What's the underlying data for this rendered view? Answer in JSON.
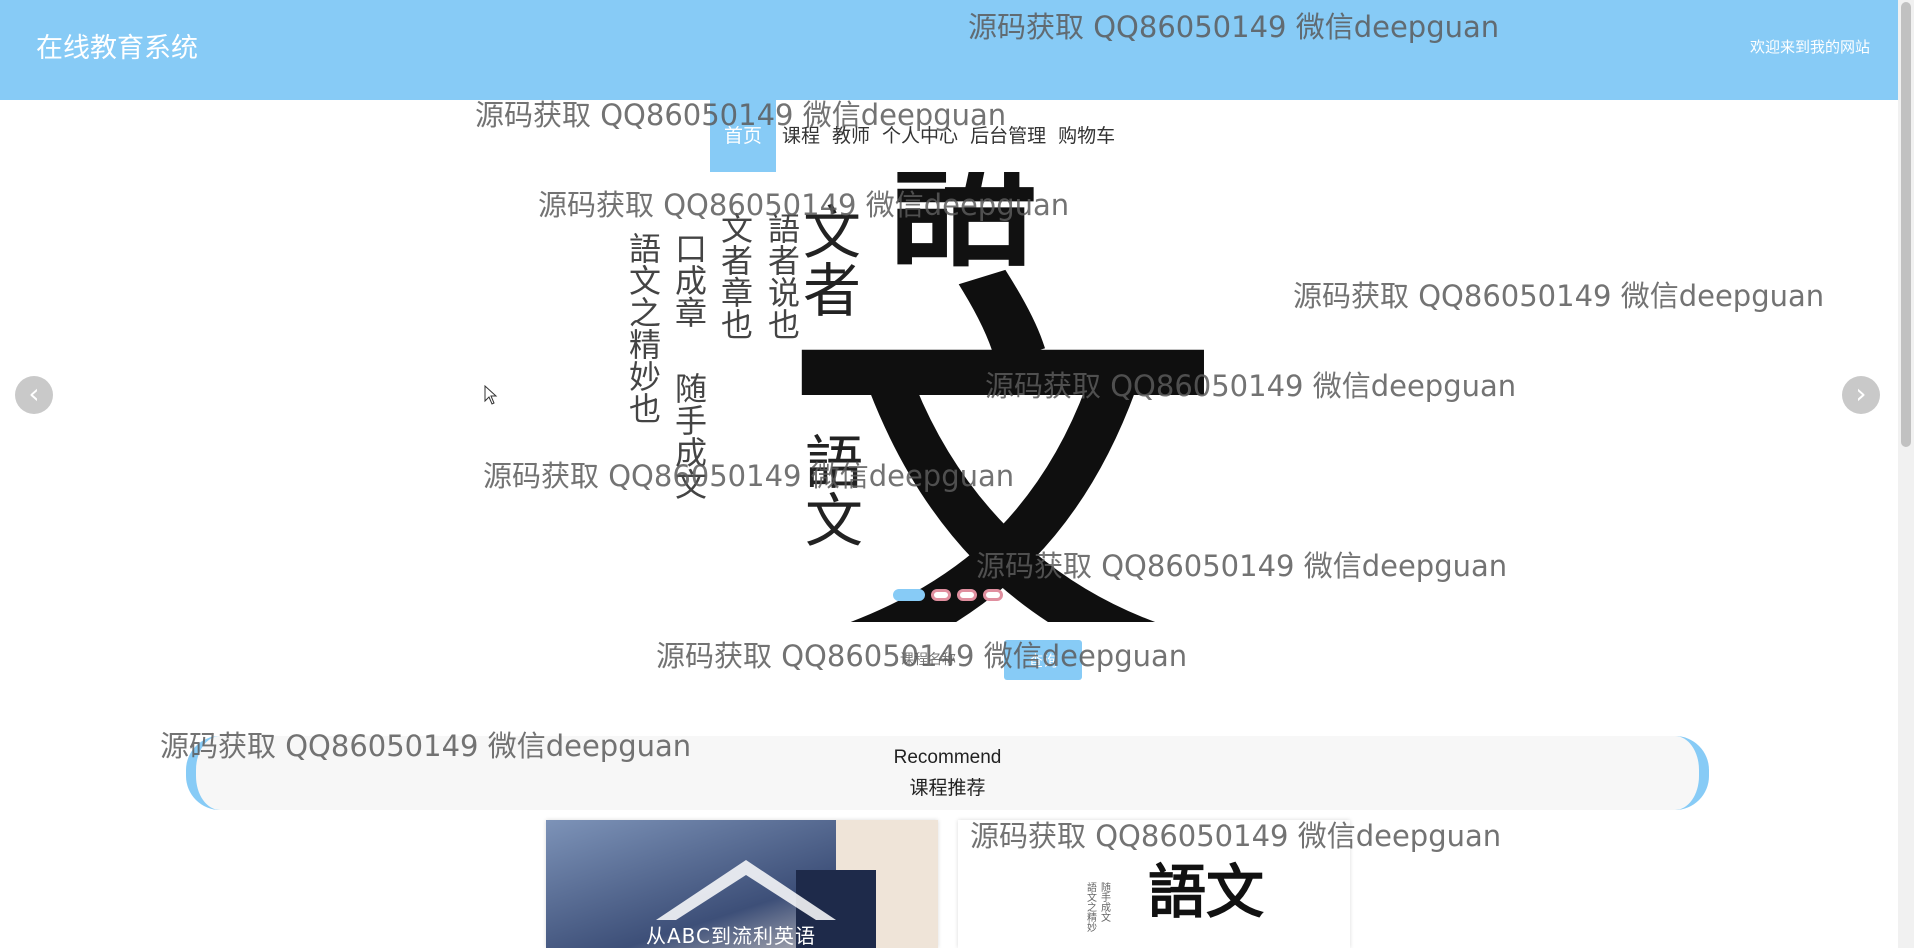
{
  "header": {
    "site_title": "在线教育系统",
    "welcome_text": "欢迎来到我的网站",
    "background_color": "#87cbf6"
  },
  "nav": {
    "items": [
      {
        "label": "首页",
        "active": true
      },
      {
        "label": "课程",
        "active": false
      },
      {
        "label": "教师",
        "active": false
      },
      {
        "label": "个人中心",
        "active": false
      },
      {
        "label": "后台管理",
        "active": false
      },
      {
        "label": "购物车",
        "active": false
      }
    ]
  },
  "carousel": {
    "prev_icon": "chevron-left-icon",
    "next_icon": "chevron-right-icon",
    "slide_count": 4,
    "active_index": 0,
    "slide_text": {
      "big_top": "語",
      "big_main": "文",
      "col1": "語文之精妙也",
      "col2": "口成章",
      "col3": "随手成文",
      "col4": "文者章也",
      "col5": "語者说也",
      "col6": "文者",
      "col7": "語文"
    }
  },
  "search": {
    "placeholder": "课程名称",
    "button_label": "查询"
  },
  "recommend": {
    "title_en": "Recommend",
    "title_cn": "课程推荐"
  },
  "cards": [
    {
      "caption": "从ABC到流利英语"
    },
    {
      "caption": "語文"
    }
  ],
  "watermark_text": "源码获取 QQ86050149 微信deepguan"
}
